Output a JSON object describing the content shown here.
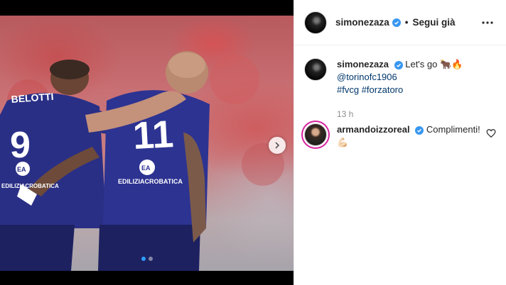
{
  "post": {
    "author": "simonezaza",
    "header_status": "Segui già",
    "separator": "•",
    "caption_text": "Let's go 🐂🔥",
    "mention": "@torinofc1906",
    "hashtags": [
      "#fvcg",
      "#forzatoro"
    ],
    "time_ago": "13 h"
  },
  "photo": {
    "jersey_left_name": "BELOTTI",
    "jersey_left_number": "9",
    "jersey_right_number": "11",
    "jersey_sponsor": "EDILIZIACROBATICA",
    "sponsor_badge": "EA"
  },
  "comments": [
    {
      "author": "armandoizzoreal",
      "text": "Complimenti! 💪🏻"
    }
  ],
  "icons": {
    "verified": "verified-badge-icon",
    "more": "more-options-icon",
    "like": "heart-icon",
    "next": "chevron-right-icon"
  },
  "colors": {
    "verified": "#3897f0",
    "link": "#00376b",
    "active_dot": "#2f9cff"
  }
}
